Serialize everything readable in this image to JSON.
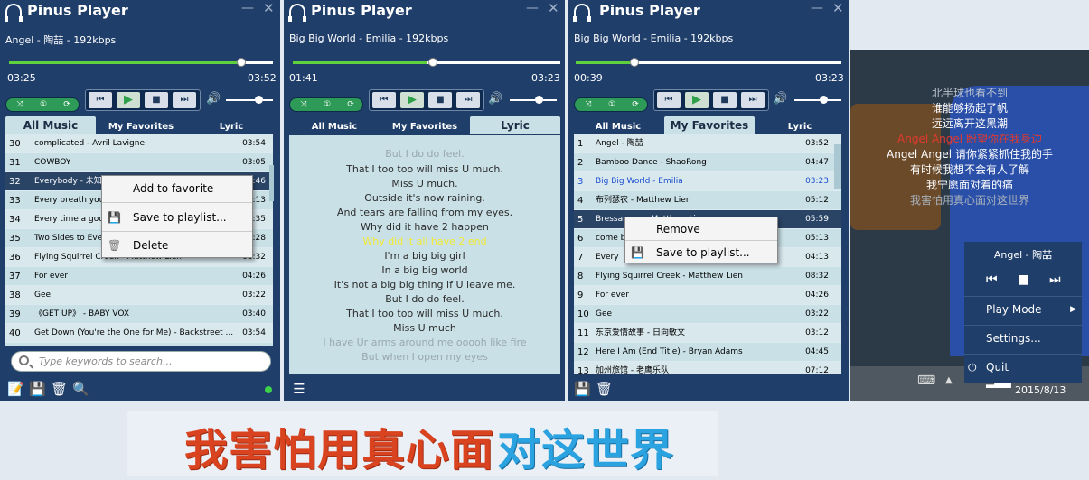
{
  "app_title": "Pinus Player",
  "tabs": [
    "All Music",
    "My Favorites",
    "Lyric"
  ],
  "mode_icons": [
    "shuffle-icon",
    "single-icon",
    "repeat-icon"
  ],
  "playback_icons": [
    "prev-icon",
    "play-icon",
    "stop-icon",
    "next-icon"
  ],
  "panel1": {
    "now_playing": "Angel - 陶喆 - 192kbps",
    "elapsed": "03:25",
    "total": "03:52",
    "progress": 0.88,
    "volume": 0.85,
    "rows": [
      {
        "n": "30",
        "t": "complicated - Avril Lavigne",
        "d": "03:54"
      },
      {
        "n": "31",
        "t": "COWBOY",
        "d": "03:05"
      },
      {
        "n": "32",
        "t": "Everybody - 未知",
        "d": "03:46"
      },
      {
        "n": "33",
        "t": "Every breath you",
        "d": "04:13"
      },
      {
        "n": "34",
        "t": "Every time a goo",
        "d": "03:35"
      },
      {
        "n": "35",
        "t": "Two Sides to Eve",
        "d": "03:28"
      },
      {
        "n": "36",
        "t": "Flying Squirrel Creek - Matthew Lien",
        "d": "08:32"
      },
      {
        "n": "37",
        "t": "For ever",
        "d": "04:26"
      },
      {
        "n": "38",
        "t": "Gee",
        "d": "03:22"
      },
      {
        "n": "39",
        "t": "《GET UP》 - BABY VOX",
        "d": "03:40"
      },
      {
        "n": "40",
        "t": "Get Down (You're the One for Me) - Backstreet ...",
        "d": "03:54"
      }
    ],
    "search_placeholder": "Type keywords to search...",
    "menu": [
      "Add to favorite",
      "Save to playlist...",
      "Delete"
    ]
  },
  "panel2": {
    "now_playing": "Big Big World - Emilia - 192kbps",
    "elapsed": "01:41",
    "total": "03:23",
    "progress": 0.5,
    "volume": 0.8,
    "lyrics": [
      "But I do do feel.",
      "That I too too will miss U much.",
      "Miss U much.",
      "Outside it's now raining.",
      "And tears are falling from my eyes.",
      "Why did it have 2 happen",
      "Why did it all have 2 end",
      "I'm a big big girl",
      "In a big big world",
      "It's not a big big thing if U leave me.",
      "But I do do feel.",
      "That I too too will miss U much.",
      "Miss U much",
      "I have Ur arms around me ooooh like fire",
      "But when I open my eyes"
    ]
  },
  "panel3": {
    "now_playing": "Big Big World - Emilia - 192kbps",
    "elapsed": "00:39",
    "total": "03:23",
    "progress": 0.2,
    "volume": 0.8,
    "rows": [
      {
        "n": "1",
        "t": "Angel - 陶喆",
        "d": "03:52"
      },
      {
        "n": "2",
        "t": "Bamboo Dance - ShaoRong",
        "d": "04:47"
      },
      {
        "n": "3",
        "t": "Big Big World - Emilia",
        "d": "03:23"
      },
      {
        "n": "4",
        "t": "布列瑟农 - Matthew Lien",
        "d": "05:12"
      },
      {
        "n": "5",
        "t": "Bressanone - Matthew Lien",
        "d": "05:59"
      },
      {
        "n": "6",
        "t": "come back",
        "d": "05:13"
      },
      {
        "n": "7",
        "t": "Every",
        "d": "04:13"
      },
      {
        "n": "8",
        "t": "Flying Squirrel Creek - Matthew Lien",
        "d": "08:32"
      },
      {
        "n": "9",
        "t": "For ever",
        "d": "04:26"
      },
      {
        "n": "10",
        "t": "Gee",
        "d": "03:22"
      },
      {
        "n": "11",
        "t": "东京爱情故事 - 日向敏文",
        "d": "03:12"
      },
      {
        "n": "12",
        "t": "Here I Am (End Title) - Bryan Adams",
        "d": "04:45"
      },
      {
        "n": "13",
        "t": "加州旅馆 - 老鹰乐队",
        "d": "07:12"
      }
    ],
    "menu": [
      "Remove",
      "Save to playlist..."
    ]
  },
  "desktop": {
    "lyrics": [
      "北半球也看不到",
      "谁能够扬起了帆",
      "远远离开这黑潮",
      "Angel Angel 盼望你在我身边",
      "Angel Angel 请你紧紧抓住我的手",
      "有时候我想不会有人了解",
      "我宁愿面对着的痛",
      "我害怕用真心面对这世界"
    ],
    "tray_song": "Angel - 陶喆",
    "tray_menu": [
      "Play Mode",
      "Settings...",
      "Quit"
    ],
    "date": "2015/8/13"
  },
  "banner": {
    "part1": "我害怕用真心面",
    "part2": "对这世界"
  },
  "colors": {
    "accent_green": "#5ed13c",
    "panel": "#1f3e6a",
    "list_bg": "#c8e0e6",
    "lyric_current": "#f2ea33",
    "lyric_red": "#e03a2f"
  }
}
